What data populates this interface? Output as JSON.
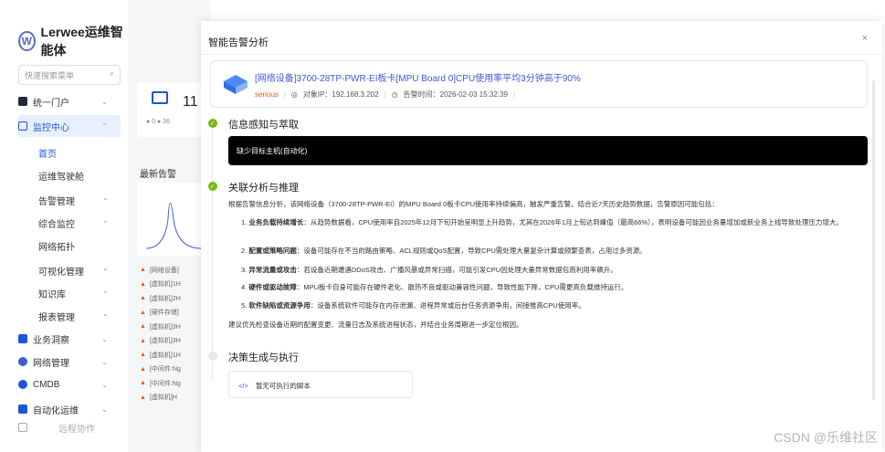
{
  "app": {
    "logo_text": "Lerwee运维智能体",
    "search_placeholder": "快速搜索菜单"
  },
  "sidebar": {
    "items": [
      {
        "label": "统一门户"
      },
      {
        "label": "监控中心"
      },
      {
        "label": "业务洞察"
      },
      {
        "label": "网络管理"
      },
      {
        "label": "CMDB"
      },
      {
        "label": "自动化运维"
      }
    ],
    "sub_items": [
      {
        "label": "首页"
      },
      {
        "label": "运维驾驶舱"
      },
      {
        "label": "告警管理"
      },
      {
        "label": "综合监控"
      },
      {
        "label": "网络拓扑"
      },
      {
        "label": "可视化管理"
      },
      {
        "label": "知识库"
      },
      {
        "label": "报表管理"
      }
    ],
    "bottom_label": "远程协作"
  },
  "background": {
    "stat_num": "11",
    "stat_dots": "● 0  ● 36",
    "alarm_title": "最新告警",
    "alarm_rows": [
      "[网络设备]",
      "[虚拟机]1H",
      "[虚拟机]2H",
      "[硬件存储]",
      "[虚拟机]3H",
      "[虚拟机]3H",
      "[虚拟机]1H",
      "[中间件:Ng",
      "[中间件:Ng",
      "[虚拟机]H"
    ]
  },
  "modal": {
    "title": "智能告警分析",
    "close": "×",
    "alert_title": "[网络设备]3700-28TP-PWR-EI板卡[MPU Board 0]CPU使用率平均3分钟高于90%",
    "severity": "serious",
    "target_ip": "对象IP：192.168.3.202",
    "alarm_time": "告警时间：2026-02-03 15:32:39",
    "steps": [
      {
        "title": "信息感知与萃取"
      },
      {
        "title": "关联分析与推理"
      },
      {
        "title": "决策生成与执行"
      }
    ],
    "perception_output": "缺少目标主机(自动化)",
    "analysis_intro": "根据告警信息分析，该网络设备（3700-28TP-PWR-EI）的MPU Board 0板卡CPU使用率持续偏高，触发严重告警。结合近7天历史趋势数据，告警原因可能包括：",
    "causes": [
      {
        "num": "1.",
        "head": "业务负载持续增长",
        "text": "：从趋势数据看，CPU使用率自2025年12月下旬开始呈明显上升趋势，尤其在2026年1月上旬达到峰值（最高66%），表明设备可能因业务量增加或新业务上线导致处理压力增大。"
      },
      {
        "num": "2.",
        "head": "配置或策略问题",
        "text": "：设备可能存在不当的路由策略、ACL规则或QoS配置，导致CPU需处理大量复杂计算或频繁查表，占用过多资源。"
      },
      {
        "num": "3.",
        "head": "异常流量或攻击",
        "text": "：若设备近期遭遇DDoS攻击、广播风暴或异常扫描，可能引发CPU因处理大量异常数据包而利用率飙升。"
      },
      {
        "num": "4.",
        "head": "硬件或驱动故障",
        "text": "：MPU板卡自身可能存在硬件老化、散热不良或驱动兼容性问题，导致性能下降，CPU需更高负载维持运行。"
      },
      {
        "num": "5.",
        "head": "软件缺陷或资源争用",
        "text": "：设备系统软件可能存在内存泄漏、进程异常或后台任务资源争用，间接推高CPU使用率。"
      }
    ],
    "analysis_conclusion": "建议优先检查设备近期的配置变更、流量日志及系统进程状态，并结合业务周期进一步定位根因。",
    "no_script": "暂无可执行的脚本"
  },
  "watermark": "CSDN @乐维社区"
}
